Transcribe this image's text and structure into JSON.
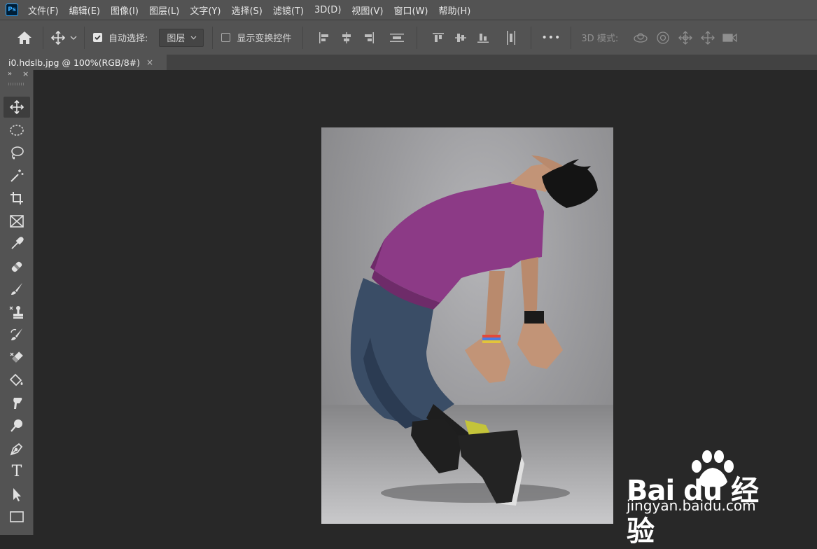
{
  "app": {
    "logo": "Ps"
  },
  "menu": [
    "文件(F)",
    "编辑(E)",
    "图像(I)",
    "图层(L)",
    "文字(Y)",
    "选择(S)",
    "滤镜(T)",
    "3D(D)",
    "视图(V)",
    "窗口(W)",
    "帮助(H)"
  ],
  "options": {
    "auto_select_label": "自动选择:",
    "auto_select_checked": true,
    "layer_dropdown_value": "图层",
    "show_transform_label": "显示变换控件",
    "show_transform_checked": false,
    "more_label": "•••",
    "mode_3d_label": "3D 模式:"
  },
  "document": {
    "tab_title": "i0.hdslb.jpg @ 100%(RGB/8#)",
    "close_glyph": "×"
  },
  "tools_panel": {
    "collapse_glyph": "»",
    "close_glyph": "×",
    "tools": [
      "move-tool",
      "elliptical-marquee-tool",
      "lasso-tool",
      "magic-wand-tool",
      "crop-tool",
      "frame-tool",
      "eyedropper-tool",
      "healing-brush-tool",
      "brush-tool",
      "clone-stamp-tool",
      "history-brush-tool",
      "eraser-tool",
      "paint-bucket-tool",
      "smudge-tool",
      "dodge-tool",
      "pen-tool",
      "type-tool",
      "path-selection-tool",
      "rectangle-tool"
    ],
    "type_tool_glyph": "T"
  },
  "watermark": {
    "brand": "Bai du 经验",
    "url": "jingyan.baidu.com"
  },
  "colors": {
    "ui_panel": "#535353",
    "workspace": "#282828",
    "shirt": "#8c3a86",
    "jeans": "#3a4d66"
  }
}
